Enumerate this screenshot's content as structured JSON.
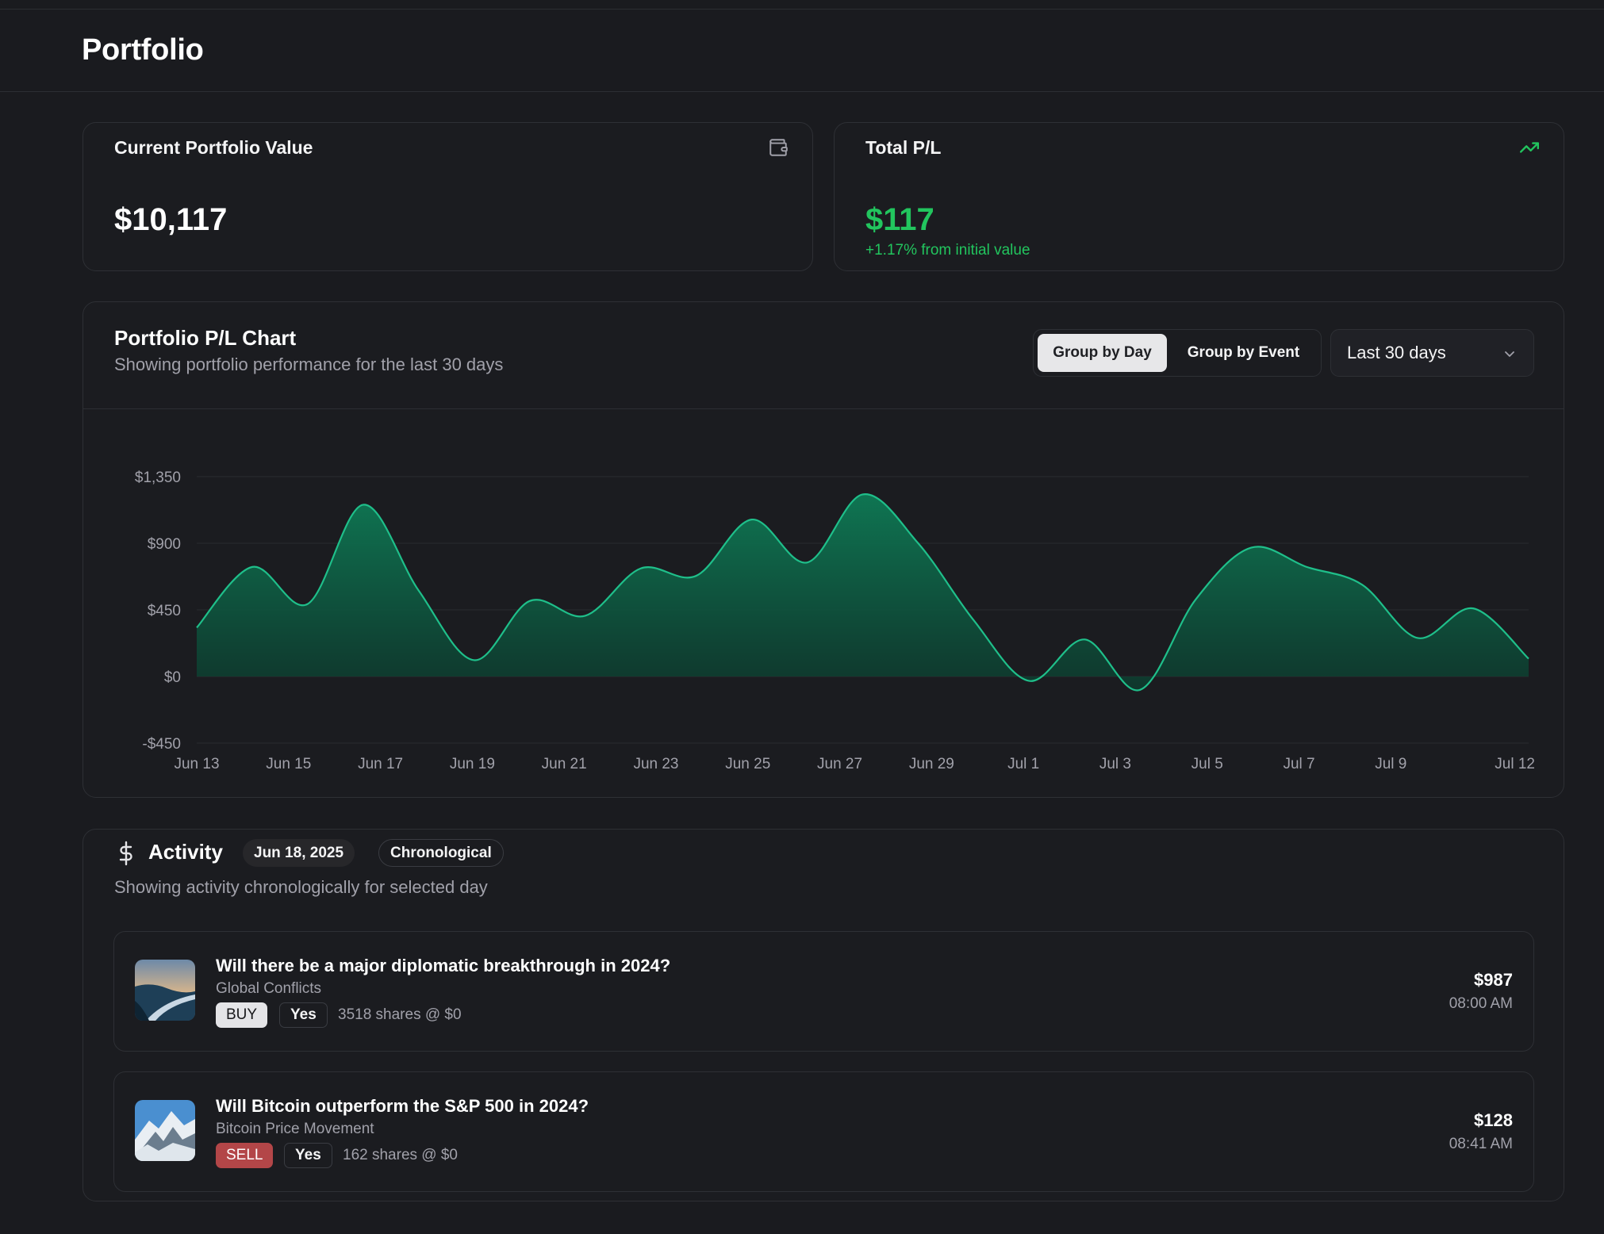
{
  "page": {
    "title": "Portfolio"
  },
  "stats": {
    "portfolio_value": {
      "label": "Current Portfolio Value",
      "value": "$10,117",
      "icon": "wallet-icon"
    },
    "total_pl": {
      "label": "Total P/L",
      "value": "$117",
      "sub": "+1.17% from initial value",
      "icon": "trending-up-icon",
      "color": "#22c55e"
    }
  },
  "chart_panel": {
    "title": "Portfolio P/L Chart",
    "description": "Showing portfolio performance for the last 30 days",
    "group_options": [
      "Group by Day",
      "Group by Event"
    ],
    "group_selected": "Group by Day",
    "range_select": "Last 30 days"
  },
  "chart_data": {
    "type": "area",
    "x": [
      "Jun 13",
      "Jun 14",
      "Jun 15",
      "Jun 16",
      "Jun 17",
      "Jun 18",
      "Jun 19",
      "Jun 20",
      "Jun 21",
      "Jun 22",
      "Jun 23",
      "Jun 24",
      "Jun 25",
      "Jun 26",
      "Jun 27",
      "Jun 28",
      "Jun 29",
      "Jun 30",
      "Jul 1",
      "Jul 2",
      "Jul 3",
      "Jul 4",
      "Jul 5",
      "Jul 6",
      "Jul 7",
      "Jul 8",
      "Jul 9",
      "Jul 10",
      "Jul 11",
      "Jul 12"
    ],
    "values": [
      330,
      740,
      490,
      1160,
      580,
      110,
      510,
      410,
      730,
      680,
      1060,
      770,
      1230,
      900,
      380,
      -30,
      250,
      -90,
      520,
      870,
      740,
      620,
      260,
      460,
      120
    ],
    "x_tick_labels": [
      "Jun 13",
      "Jun 15",
      "Jun 17",
      "Jun 19",
      "Jun 21",
      "Jun 23",
      "Jun 25",
      "Jun 27",
      "Jun 29",
      "Jul 1",
      "Jul 3",
      "Jul 5",
      "Jul 7",
      "Jul 9",
      "Jul 12"
    ],
    "y_tick_labels": [
      "$1,350",
      "$900",
      "$450",
      "$0",
      "-$450"
    ],
    "ylim": [
      -450,
      1350
    ],
    "grid": true,
    "line_color": "#1fbf8a",
    "fill_color": "#0d6b4d"
  },
  "activity": {
    "title": "Activity",
    "date": "Jun 18, 2025",
    "mode": "Chronological",
    "description": "Showing activity chronologically for selected day",
    "icon": "dollar-icon",
    "items": [
      {
        "title": "Will there be a major diplomatic breakthrough in 2024?",
        "category": "Global Conflicts",
        "side": "BUY",
        "outcome": "Yes",
        "shares": "3518 shares @ $0",
        "amount": "$987",
        "time": "08:00 AM",
        "thumb": "coastal-road-thumbnail"
      },
      {
        "title": "Will Bitcoin outperform the S&P 500 in 2024?",
        "category": "Bitcoin Price Movement",
        "side": "SELL",
        "outcome": "Yes",
        "shares": "162 shares @ $0",
        "amount": "$128",
        "time": "08:41 AM",
        "thumb": "snowy-mountain-thumbnail"
      }
    ]
  }
}
